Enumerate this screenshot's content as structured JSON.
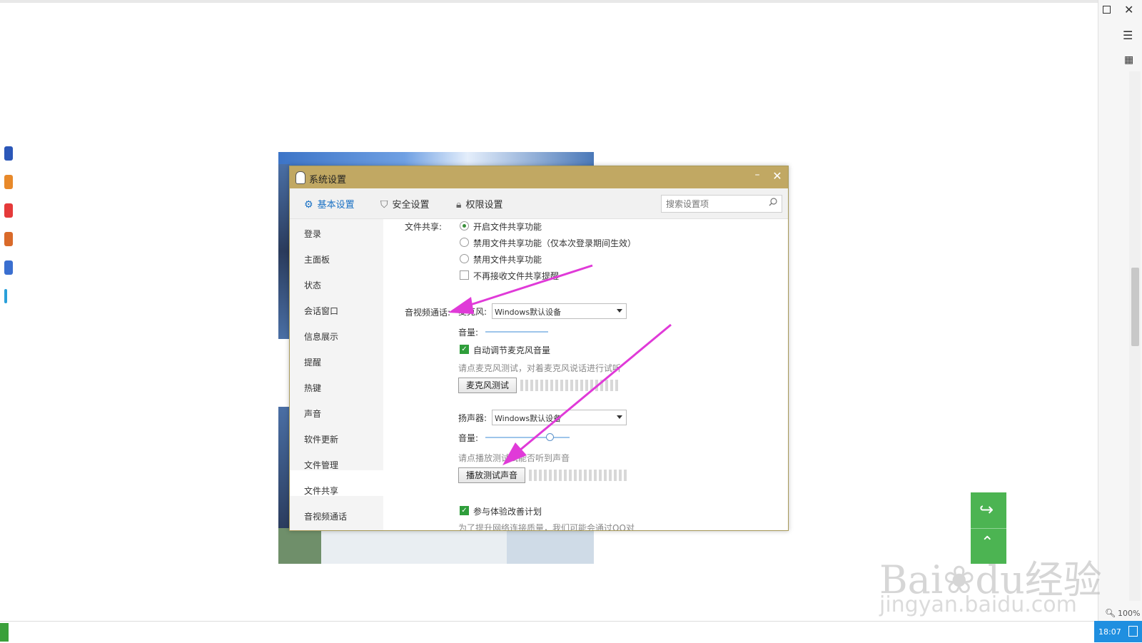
{
  "dialog": {
    "title": "系统设置",
    "tabs": [
      {
        "label": "基本设置",
        "icon": "gear-icon"
      },
      {
        "label": "安全设置",
        "icon": "shield-icon"
      },
      {
        "label": "权限设置",
        "icon": "lock-icon"
      }
    ],
    "search_placeholder": "搜索设置项"
  },
  "sidebar": {
    "items": [
      "登录",
      "主面板",
      "状态",
      "会话窗口",
      "信息展示",
      "提醒",
      "热键",
      "声音",
      "软件更新",
      "文件管理",
      "文件共享",
      "音视频通话"
    ],
    "active": "文件共享"
  },
  "file_share": {
    "label": "文件共享:",
    "options": [
      "开启文件共享功能",
      "禁用文件共享功能（仅本次登录期间生效）",
      "禁用文件共享功能"
    ],
    "selected": "开启文件共享功能",
    "no_remind": "不再接收文件共享提醒"
  },
  "av_call": {
    "label": "音视频通话:",
    "mic_label": "麦克风:",
    "mic_device": "Windows默认设备",
    "volume_label": "音量:",
    "auto_adjust": "自动调节麦克风音量",
    "mic_hint": "请点麦克风测试，对着麦克风说话进行试听",
    "mic_test_button": "麦克风测试",
    "speaker_label": "扬声器:",
    "speaker_device": "Windows默认设备",
    "speaker_volume_label": "音量:",
    "speaker_volume_level": 0.72,
    "speaker_hint": "请点播放测试试能否听到声音",
    "play_test_button": "播放测试声音",
    "experience_plan": "参与体验改善计划",
    "experience_hint": "为了提升网络连接质量，我们可能会通过QQ对"
  },
  "system": {
    "time": "18:07",
    "zoom": "100%"
  },
  "watermark": {
    "brand": "Bai",
    "brand_cn": "经验",
    "url": "jingyan.baidu.com"
  },
  "colors": {
    "titlebar": "#c1a863",
    "accent": "#1a71c4",
    "arrow": "#e03ad8",
    "check": "#2f9e3b"
  }
}
